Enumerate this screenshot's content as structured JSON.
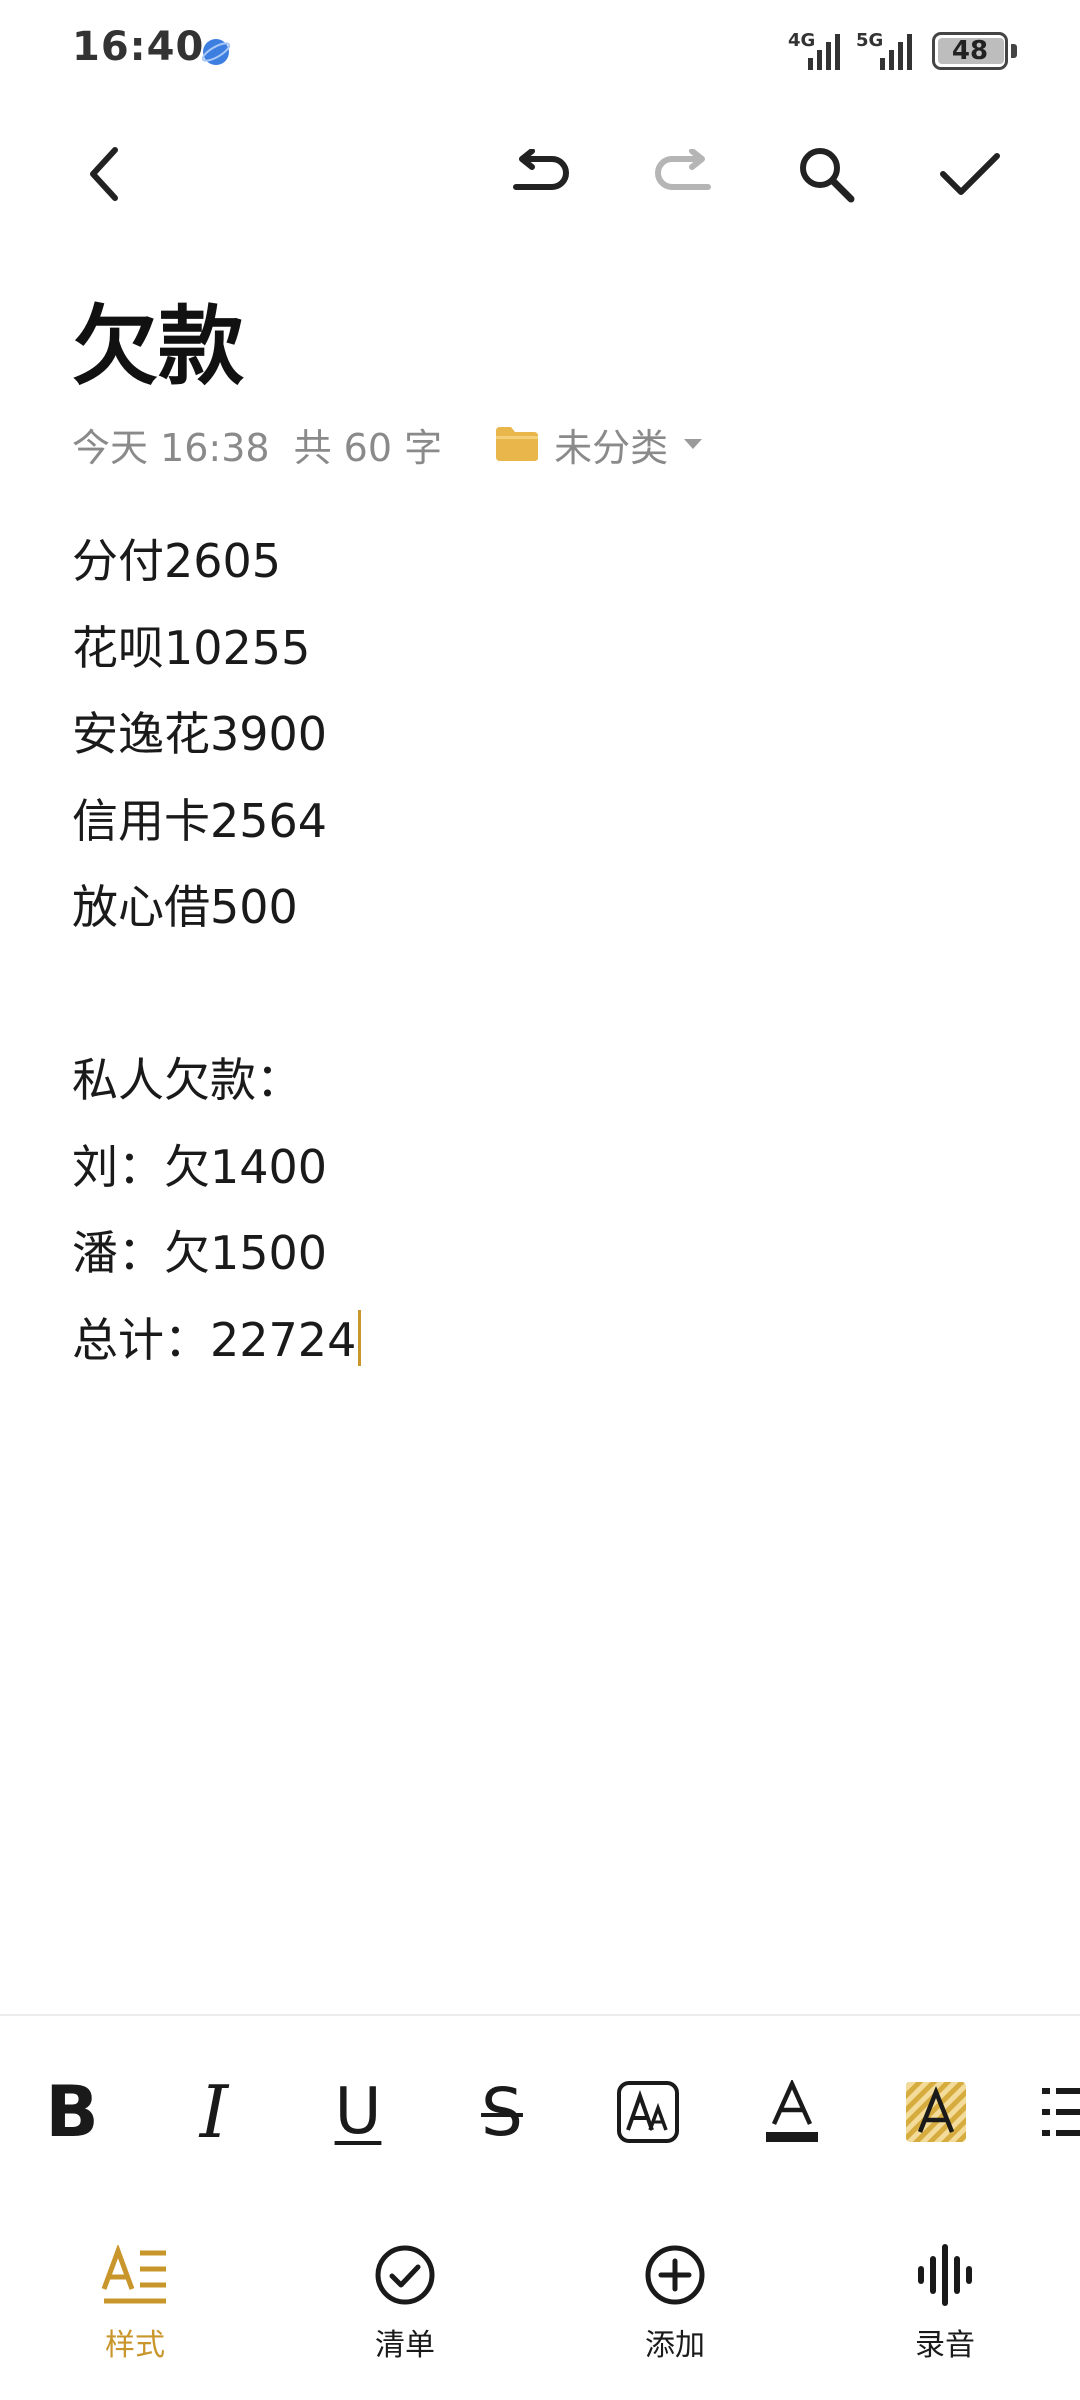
{
  "status_bar": {
    "time": "16:40",
    "network_1": "4G",
    "network_2": "5G",
    "battery": "48"
  },
  "toolbar": {
    "back_icon": "chevron-left-icon",
    "undo_icon": "undo-icon",
    "redo_icon": "redo-icon",
    "search_icon": "search-icon",
    "done_icon": "check-icon"
  },
  "note": {
    "title": "欠款",
    "date": "今天 16:38",
    "word_count": "共 60 字",
    "folder": "未分类",
    "lines": [
      "分付2605",
      "花呗10255",
      "安逸花3900",
      "信用卡2564",
      "放心借500",
      "",
      "私人欠款：",
      "刘：欠1400",
      "潘：欠1500",
      "总计：22724"
    ]
  },
  "format_bar": {
    "bold": "B",
    "italic": "I",
    "underline": "U",
    "strikethrough": "S"
  },
  "bottom_nav": {
    "items": [
      {
        "label": "样式",
        "icon": "text-style-icon",
        "active": true
      },
      {
        "label": "清单",
        "icon": "checklist-icon",
        "active": false
      },
      {
        "label": "添加",
        "icon": "add-circle-icon",
        "active": false
      },
      {
        "label": "录音",
        "icon": "voice-wave-icon",
        "active": false
      }
    ]
  },
  "colors": {
    "accent": "#c9962b",
    "folder": "#e8b64a",
    "meta_text": "#8a8a8a",
    "disabled": "#b5b5b5"
  }
}
